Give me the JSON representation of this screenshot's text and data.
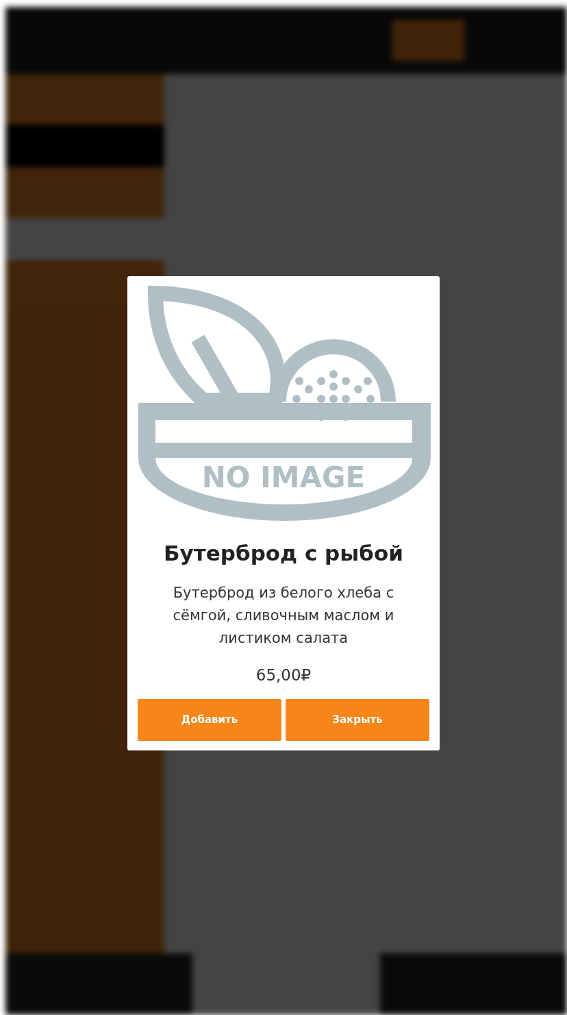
{
  "dialog": {
    "image_label": "NO IMAGE",
    "title": "Бутерброд с рыбой",
    "description": "Бутерброд из белого хлеба с сёмгой, сливочным маслом и листиком салата",
    "price": "65,00₽",
    "buttons": [
      {
        "label": "Добавить"
      },
      {
        "label": "Закрыть"
      }
    ]
  }
}
